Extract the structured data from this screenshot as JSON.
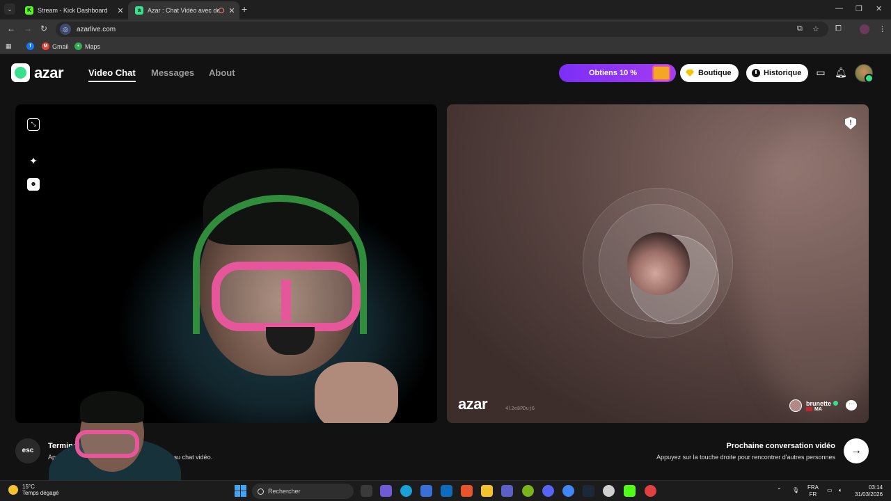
{
  "browser": {
    "tabs": [
      {
        "title": "Stream - Kick Dashboard",
        "favicon_color": "#53fc18"
      },
      {
        "title": "Azar : Chat Vidéo avec de n",
        "favicon_color": "#39e08c"
      }
    ],
    "url": "azarlive.com",
    "bookmarks": [
      {
        "label": ""
      },
      {
        "label": "Gmail"
      },
      {
        "label": "Maps"
      }
    ]
  },
  "header": {
    "logo_text": "azar",
    "nav": [
      {
        "label": "Video Chat",
        "active": true
      },
      {
        "label": "Messages",
        "active": false
      },
      {
        "label": "About",
        "active": false
      }
    ],
    "promo_label": "Obtiens 10 %",
    "shop_label": "Boutique",
    "history_label": "Historique"
  },
  "peer": {
    "watermark": "azar",
    "session_id": "4l2e8PDuj6",
    "name": "brunette",
    "country": "MA"
  },
  "hints": {
    "esc_key": "esc",
    "end_title": "Terminer le chat vidéo",
    "end_sub": "Appuyez sur la touche Échap pour mettre fin au chat vidéo.",
    "next_title": "Prochaine conversation vidéo",
    "next_sub": "Appuyez sur la touche droite pour rencontrer d'autres personnes",
    "next_symbol": "→"
  },
  "taskbar": {
    "temperature": "15°C",
    "weather": "Temps dégagé",
    "search_placeholder": "Rechercher",
    "lang_top": "FRA",
    "lang_bottom": "FR",
    "time": "03:14",
    "date": "31/03/2026"
  },
  "colors": {
    "accent": "#39e08c",
    "promo": "#7b2ff7"
  }
}
